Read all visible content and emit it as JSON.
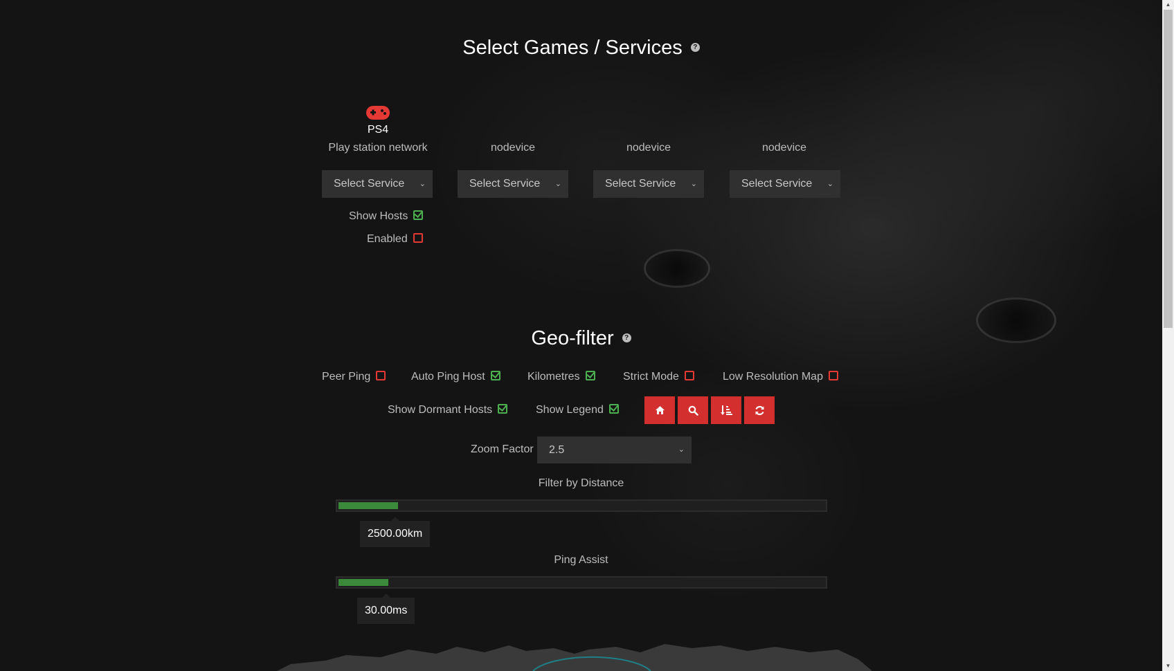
{
  "services_section": {
    "title": "Select Games / Services",
    "help_icon": "question-circle-icon",
    "devices": [
      {
        "icon": "gamepad-icon",
        "name": "PS4",
        "subtitle": "Play station network",
        "select_value": "Select Service"
      },
      {
        "icon": "",
        "name": "",
        "subtitle": "nodevice",
        "select_value": "Select Service"
      },
      {
        "icon": "",
        "name": "",
        "subtitle": "nodevice",
        "select_value": "Select Service"
      },
      {
        "icon": "",
        "name": "",
        "subtitle": "nodevice",
        "select_value": "Select Service"
      }
    ],
    "show_hosts": {
      "label": "Show Hosts",
      "checked": true
    },
    "enabled": {
      "label": "Enabled",
      "checked": false
    }
  },
  "geo_filter": {
    "title": "Geo-filter",
    "help_icon": "question-circle-icon",
    "options_row1": [
      {
        "label": "Peer Ping",
        "checked": false
      },
      {
        "label": "Auto Ping Host",
        "checked": true
      },
      {
        "label": "Kilometres",
        "checked": true
      },
      {
        "label": "Strict Mode",
        "checked": false
      },
      {
        "label": "Low Resolution Map",
        "checked": false
      }
    ],
    "options_row2": [
      {
        "label": "Show Dormant Hosts",
        "checked": true
      },
      {
        "label": "Show Legend",
        "checked": true
      }
    ],
    "buttons": [
      {
        "icon": "home-icon"
      },
      {
        "icon": "search-icon"
      },
      {
        "icon": "sort-amount-icon"
      },
      {
        "icon": "refresh-icon"
      }
    ],
    "zoom_factor": {
      "label": "Zoom Factor",
      "value": "2.5"
    },
    "distance_filter": {
      "label": "Filter by Distance",
      "value_text": "2500.00km",
      "fill_fraction": 0.122
    },
    "ping_assist": {
      "label": "Ping Assist",
      "value_text": "30.00ms",
      "fill_fraction": 0.102
    }
  },
  "colors": {
    "accent_red": "#d32f2f",
    "check_green": "#4caf50",
    "check_red": "#e53935",
    "slider_green": "#3b8a3b"
  }
}
